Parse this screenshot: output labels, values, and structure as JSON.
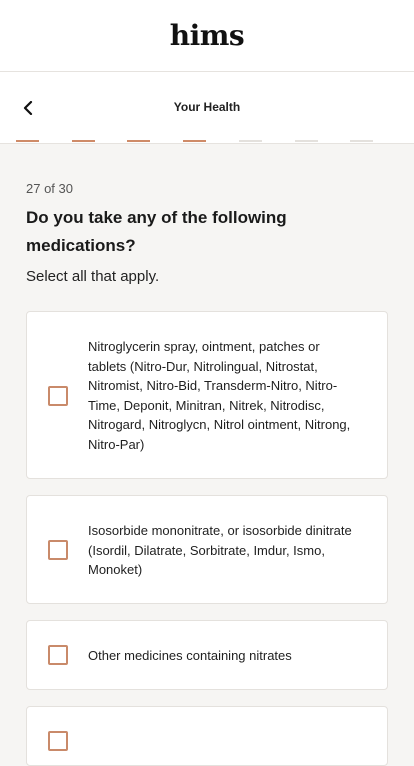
{
  "header": {
    "logo": "hims"
  },
  "subheader": {
    "title": "Your Health",
    "back_icon": "chevron-left-icon"
  },
  "progress": {
    "completed_segments": 4,
    "total_segments": 7
  },
  "question": {
    "counter": "27 of 30",
    "title": "Do you take any of the following medications?",
    "instruction": "Select all that apply."
  },
  "options": [
    {
      "label": "Nitroglycerin spray, ointment, patches or tablets (Nitro-Dur, Nitrolingual, Nitrostat, Nitromist, Nitro-Bid, Transderm-Nitro, Nitro-Time, Deponit, Minitran, Nitrek, Nitrodisc, Nitrogard, Nitroglycn, Nitrol ointment, Nitrong, Nitro-Par)",
      "checked": false
    },
    {
      "label": "Isosorbide mononitrate, or isosorbide dinitrate (Isordil, Dilatrate, Sorbitrate, Imdur, Ismo, Monoket)",
      "checked": false
    },
    {
      "label": "Other medicines containing nitrates",
      "checked": false
    },
    {
      "label": "",
      "checked": false
    }
  ],
  "colors": {
    "accent": "#cf8b68",
    "background": "#f6f5f3",
    "card": "#ffffff",
    "progress_inactive": "#e4e1dd"
  }
}
